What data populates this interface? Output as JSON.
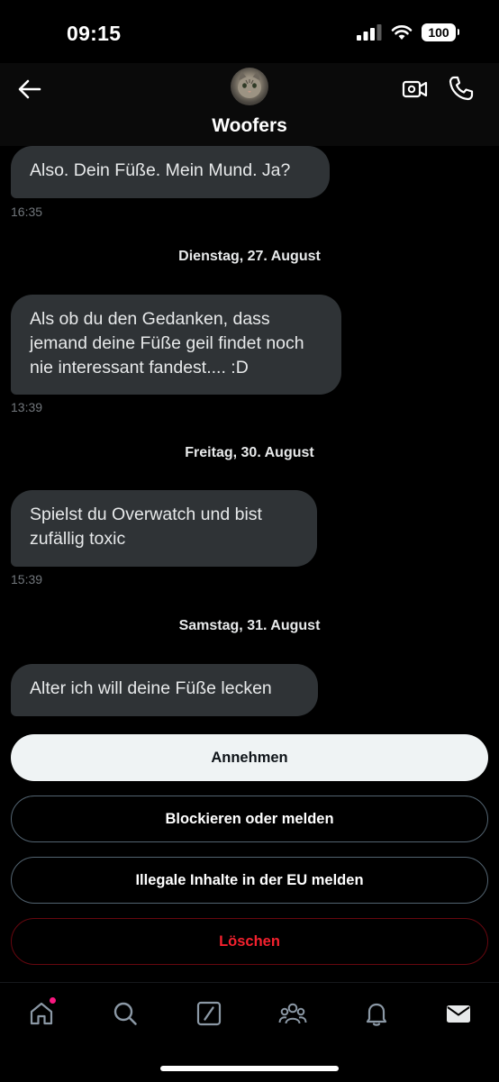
{
  "status_bar": {
    "time": "09:15",
    "battery": "100"
  },
  "header": {
    "contact_name": "Woofers"
  },
  "messages": [
    {
      "text": "Also. Dein Füße. Mein Mund. Ja?",
      "time": "16:35"
    },
    {
      "date": "Dienstag, 27. August"
    },
    {
      "text": "Als ob du den Gedanken, dass jemand deine Füße geil findet noch nie interessant fandest.... :D",
      "time": "13:39"
    },
    {
      "date": "Freitag, 30. August"
    },
    {
      "text": "Spielst du Overwatch und bist zufällig toxic",
      "time": "15:39"
    },
    {
      "date": "Samstag, 31. August"
    },
    {
      "text": "Alter ich will deine Füße lecken"
    }
  ],
  "actions": {
    "accept": "Annehmen",
    "block_report": "Blockieren oder melden",
    "report_illegal_eu": "Illegale Inhalte in der EU melden",
    "delete": "Löschen"
  },
  "tabs": [
    "home-icon",
    "search-icon",
    "compose-icon",
    "communities-icon",
    "bell-icon",
    "mail-icon"
  ],
  "colors": {
    "accent_danger": "#f4212e",
    "bubble": "#2f3336",
    "notification_dot": "#f91880"
  }
}
